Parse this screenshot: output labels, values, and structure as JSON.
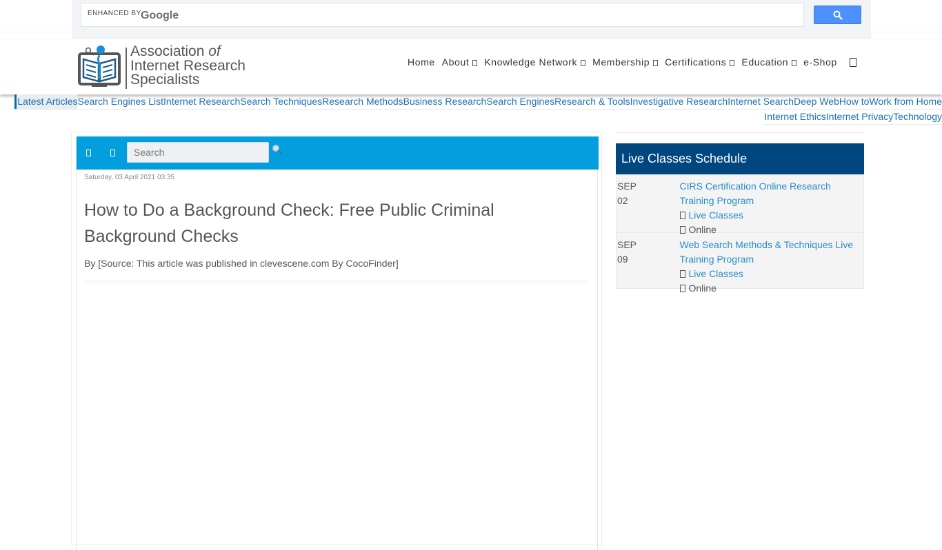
{
  "google_search": {
    "enhanced_label": "enhanced by",
    "brand": "Google",
    "button_icon": "search-icon",
    "button_color": "#4d90fe"
  },
  "logo": {
    "line1": "Association",
    "line1_em": "of",
    "line2": "Internet Research",
    "line3": "Specialists"
  },
  "main_nav": [
    {
      "label": "Home",
      "has_dropdown": false
    },
    {
      "label": "About",
      "has_dropdown": true
    },
    {
      "label": "Knowledge Network",
      "has_dropdown": true
    },
    {
      "label": "Membership",
      "has_dropdown": true
    },
    {
      "label": "Certifications",
      "has_dropdown": true
    },
    {
      "label": "Education",
      "has_dropdown": true
    },
    {
      "label": "e-Shop",
      "has_dropdown": false
    }
  ],
  "categories": {
    "row1": [
      "Latest Articles",
      "Search Engines List",
      "Internet Research",
      "Search Techniques",
      "Research Methods",
      "Business Research",
      "Search Engines",
      "Research & Tools",
      "Investigative Research",
      "Internet Search",
      "Deep Web",
      "How to",
      "Work from Home"
    ],
    "row2": [
      "Internet Ethics",
      "Internet Privacy",
      "Technology"
    ],
    "active": "Latest Articles"
  },
  "article_toolbar": {
    "search_placeholder": "Search",
    "bar_color": "#029ede"
  },
  "article": {
    "date": "Saturday, 03 April 2021 03:35",
    "title": "How to Do a Background Check: Free Public Criminal Background Checks",
    "byline": "By  [Source: This article was published in clevescene.com By CocoFinder]"
  },
  "sidebar": {
    "schedule_title": "Live Classes Schedule",
    "header_color": "#00467f",
    "events": [
      {
        "month": "SEP",
        "day": "02",
        "title": "CIRS Certification Online Research Training Program",
        "category": "Live Classes",
        "location": "Online"
      },
      {
        "month": "SEP",
        "day": "09",
        "title": "Web Search Methods & Techniques Live Training Program",
        "category": "Live Classes",
        "location": "Online"
      }
    ]
  }
}
